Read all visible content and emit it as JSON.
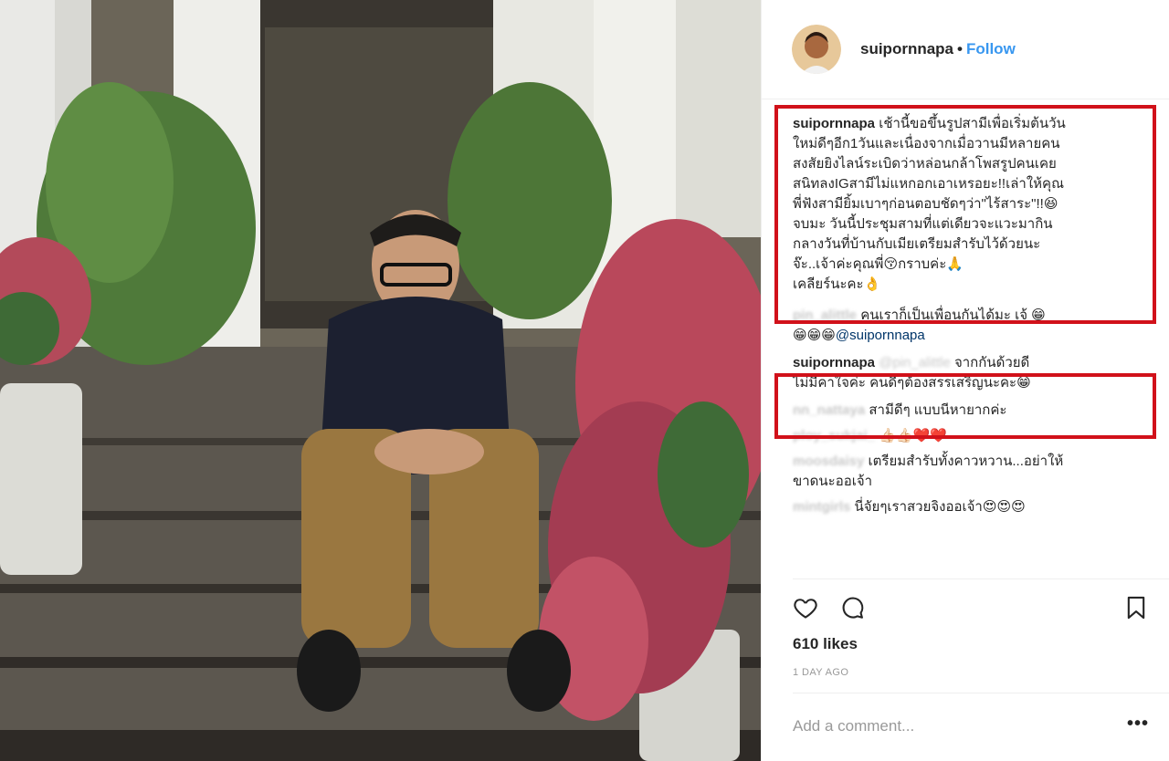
{
  "colors": {
    "accent": "#3897f0",
    "highlight_box": "#d1111a",
    "muted": "#999999"
  },
  "header": {
    "username": "suipornnapa",
    "separator": "•",
    "follow_label": "Follow"
  },
  "comments": [
    {
      "user": "suipornnapa",
      "lines": [
        "เช้านี้ขอขึ้นรูปสามีเพื่อเริ่มต้นวัน",
        "ใหม่ดีๆอีก1วันและเนื่องจากเมื่อวานมีหลายคน",
        "สงสัยยิงไลน์ระเบิดว่าหล่อนกล้าโพสรูปคนเคย",
        "สนิทลงIGสามีไม่แหกอกเอาเหรอยะ!!เล่าให้คุณ",
        "พี่ฟังสามียิ้มเบาๆก่อนตอบชัดๆว่า\"ไร้สาระ\"!!😆",
        "จบมะ วันนี้ประชุมสามที่แต่เดียวจะแวะมากิน",
        "กลางวันที่บ้านกับเมียเตรียมสำรับไว้ด้วยนะ",
        "จ๊ะ..เจ้าค่ะคุณพี่😚กราบค่ะ🙏",
        "เคลียร์นะคะ👌"
      ]
    },
    {
      "user_blurred": "pin_alittle",
      "text": "คนเราก็เป็นเพื่อนกันได้มะ เจ้ 😁",
      "text2": "😁😁😁",
      "mention": "@suipornnapa"
    },
    {
      "user": "suipornnapa",
      "mention_blurred": "@pin_alittle",
      "text": "จากกันด้วยดี",
      "text2": "ไม่มีคาใจค่ะ คนดีๆต้องสรรเสริญนะคะ😁"
    },
    {
      "user_blurred": "nn_nattaya",
      "text": "สามีดีๆ แบบนีหายากค่ะ"
    },
    {
      "user_blurred": "ploy_sukjai_",
      "text": "👍🏻👍🏻❤️❤️"
    },
    {
      "user_blurred": "moosdaisy",
      "text": "เตรียมสำรับทั้งคาวหวาน...อย่าให้",
      "text2": "ขาดนะออเจ้า"
    },
    {
      "user_blurred": "mintgirls",
      "text": "นี่จัยๆเราสวยจิงออเจ้า😍😍😍"
    }
  ],
  "icons": {
    "like": "heart-icon",
    "comment": "comment-icon",
    "save": "bookmark-icon",
    "more": "more-icon"
  },
  "likes_text": "610 likes",
  "time_ago": "1 DAY AGO",
  "add_comment_placeholder": "Add a comment...",
  "more_label": "•••"
}
